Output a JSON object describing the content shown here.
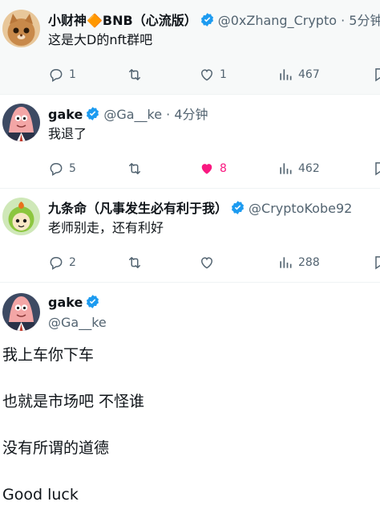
{
  "replies": [
    {
      "name": "小财神🔶BNB（心流版）",
      "handle": "@0xZhang_Crypto",
      "time": "5分钟",
      "text": "这是大D的nft群吧",
      "reply_count": "1",
      "retweet_count": "",
      "like_count": "1",
      "views": "467",
      "liked": false
    },
    {
      "name": "gake",
      "handle": "@Ga__ke",
      "time": "4分钟",
      "text": "我退了",
      "reply_count": "5",
      "retweet_count": "",
      "like_count": "8",
      "views": "462",
      "liked": true
    },
    {
      "name": "九条命（凡事发生必有利于我）",
      "handle": "@CryptoKobe92",
      "time": "",
      "text": "老师别走，还有利好",
      "reply_count": "2",
      "retweet_count": "",
      "like_count": "",
      "views": "288",
      "liked": false
    }
  ],
  "main_tweet": {
    "name": "gake",
    "handle": "@Ga__ke",
    "text": "我上车你下车\n\n也就是市场吧 不怪谁\n\n没有所谓的道德\n\nGood luck"
  },
  "colors": {
    "verified": "#1d9bf0",
    "like_active": "#f91880",
    "muted": "#536471"
  },
  "separator": " · "
}
